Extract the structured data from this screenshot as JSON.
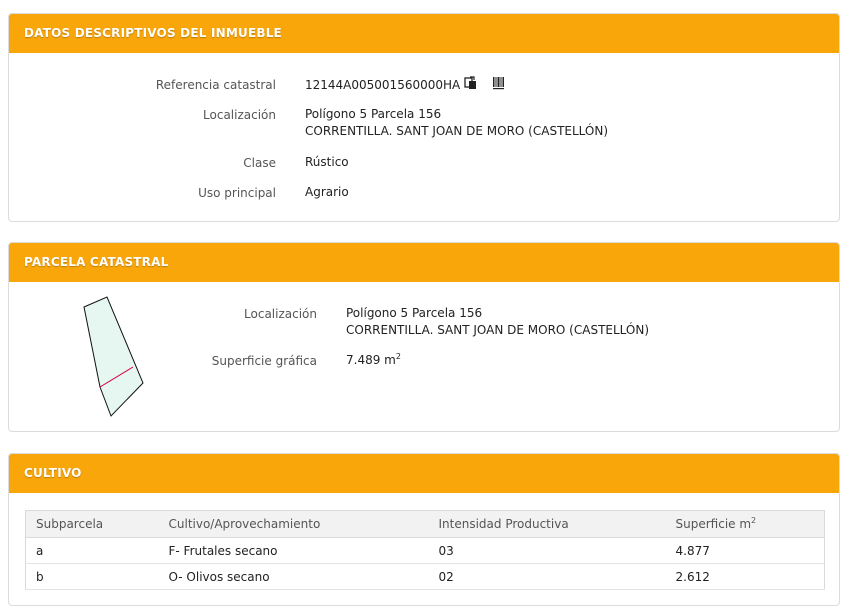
{
  "colors": {
    "header": "#f9a60b",
    "parcel_fill": "#e6f7f2",
    "parcel_line": "#d9003a"
  },
  "datos": {
    "title": "DATOS DESCRIPTIVOS DEL INMUEBLE",
    "ref_label": "Referencia catastral",
    "ref_value": "12144A005001560000HA",
    "loc_label": "Localización",
    "loc_line1": "Polígono 5 Parcela 156",
    "loc_line2": "CORRENTILLA. SANT JOAN DE MORO (CASTELLÓN)",
    "clase_label": "Clase",
    "clase_value": "Rústico",
    "uso_label": "Uso principal",
    "uso_value": "Agrario",
    "icons": [
      "copy-icon",
      "barcode-icon"
    ]
  },
  "parcela": {
    "title": "PARCELA CATASTRAL",
    "loc_label": "Localización",
    "loc_line1": "Polígono 5 Parcela 156",
    "loc_line2": "CORRENTILLA. SANT JOAN DE MORO (CASTELLÓN)",
    "sup_label": "Superficie gráfica",
    "sup_value": "7.489 m",
    "sup_unit_exp": "2"
  },
  "cultivo": {
    "title": "CULTIVO",
    "headers": [
      "Subparcela",
      "Cultivo/Aprovechamiento",
      "Intensidad Productiva",
      "Superficie m"
    ],
    "header_sup_exp": "2",
    "rows": [
      [
        "a",
        "F- Frutales secano",
        "03",
        "4.877"
      ],
      [
        "b",
        "O- Olivos secano",
        "02",
        "2.612"
      ]
    ]
  }
}
